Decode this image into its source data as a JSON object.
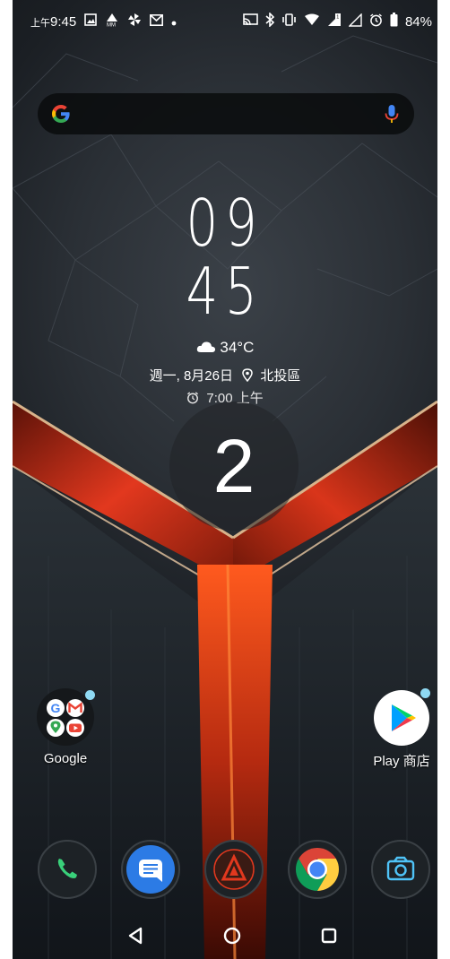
{
  "status_bar": {
    "ampm": "上午",
    "time": "9:45",
    "battery": "84%"
  },
  "search": {
    "logo": "G"
  },
  "clock_widget": {
    "hour": "09",
    "minute": "45",
    "temperature": "34°C",
    "date_text": "週一, 8月26日",
    "location": "北投區",
    "alarm": "7:00 上午"
  },
  "countdown": {
    "number": "2"
  },
  "home_apps": {
    "folder_label": "Google",
    "play_label": "Play 商店"
  },
  "dock": {
    "items": [
      "phone-icon",
      "messages-icon",
      "armoury-icon",
      "chrome-icon",
      "camera-icon"
    ]
  },
  "colors": {
    "accent_red": "#e2381e",
    "badge": "#8fd9f3",
    "messages_blue": "#2c7be5"
  }
}
